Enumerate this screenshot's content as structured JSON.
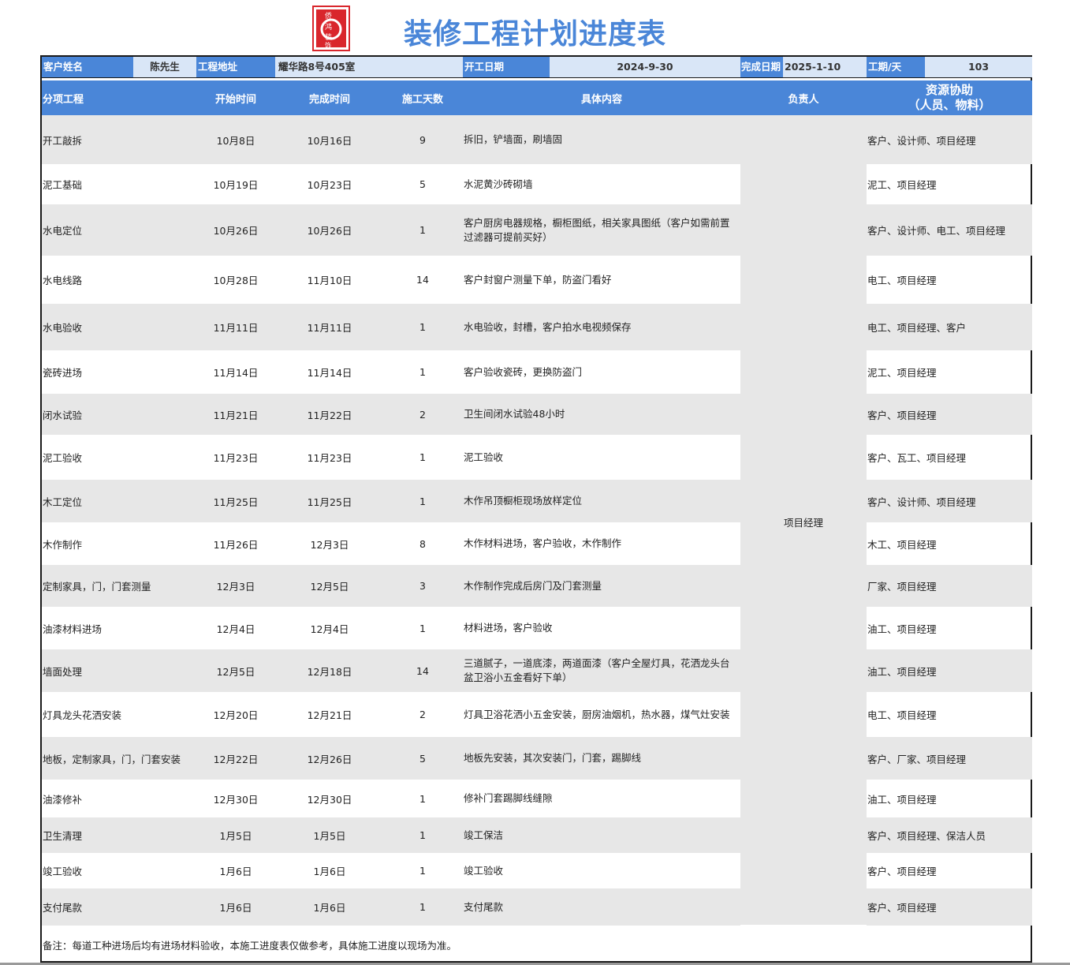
{
  "title": "装修工程计划进度表",
  "logo": {
    "text": "侨鸿装饰",
    "color": "#d9262c"
  },
  "colors": {
    "accent": "#4a86d8",
    "light": "#d9e6f7",
    "stripe": "#e7e7e7"
  },
  "info": {
    "customer_label": "客户姓名",
    "customer_value": "陈先生",
    "address_label": "工程地址",
    "address_value": "耀华路8号405室",
    "start_label": "开工日期",
    "start_value": "2024-9-30",
    "finish_label": "完成日期",
    "finish_value": "2025-1-10",
    "duration_label": "工期/天",
    "duration_value": "103"
  },
  "headers": {
    "item": "分项工程",
    "start": "开始时间",
    "end": "完成时间",
    "days": "施工天数",
    "content": "具体内容",
    "leader": "负责人",
    "resource_1": "资源协助",
    "resource_2": "（人员、物料）"
  },
  "leader": "项目经理",
  "rows": [
    {
      "item": "开工敲拆",
      "start": "10月8日",
      "end": "10月16日",
      "days": "9",
      "content": "拆旧，铲墙面，刷墙固",
      "resource": "客户、设计师、项目经理"
    },
    {
      "item": "泥工基础",
      "start": "10月19日",
      "end": "10月23日",
      "days": "5",
      "content": "水泥黄沙砖砌墙",
      "resource": "泥工、项目经理"
    },
    {
      "item": "水电定位",
      "start": "10月26日",
      "end": "10月26日",
      "days": "1",
      "content": "客户厨房电器规格，橱柜图纸，相关家具图纸（客户如需前置过滤器可提前买好）",
      "resource": "客户、设计师、电工、项目经理"
    },
    {
      "item": "水电线路",
      "start": "10月28日",
      "end": "11月10日",
      "days": "14",
      "content": "客户封窗户测量下单，防盗门看好",
      "resource": "电工、项目经理"
    },
    {
      "item": "水电验收",
      "start": "11月11日",
      "end": "11月11日",
      "days": "1",
      "content": "水电验收，封槽，客户拍水电视频保存",
      "resource": "电工、项目经理、客户"
    },
    {
      "item": "瓷砖进场",
      "start": "11月14日",
      "end": "11月14日",
      "days": "1",
      "content": "客户验收瓷砖，更换防盗门",
      "resource": "泥工、项目经理"
    },
    {
      "item": "闭水试验",
      "start": "11月21日",
      "end": "11月22日",
      "days": "2",
      "content": "卫生间闭水试验48小时",
      "resource": "客户、项目经理"
    },
    {
      "item": "泥工验收",
      "start": "11月23日",
      "end": "11月23日",
      "days": "1",
      "content": "泥工验收",
      "resource": "客户、瓦工、项目经理"
    },
    {
      "item": "木工定位",
      "start": "11月25日",
      "end": "11月25日",
      "days": "1",
      "content": "木作吊顶橱柜现场放样定位",
      "resource": "客户、设计师、项目经理"
    },
    {
      "item": "木作制作",
      "start": "11月26日",
      "end": "12月3日",
      "days": "8",
      "content": "木作材料进场，客户验收，木作制作",
      "resource": "木工、项目经理"
    },
    {
      "item": "定制家具，门，门套测量",
      "start": "12月3日",
      "end": "12月5日",
      "days": "3",
      "content": "木作制作完成后房门及门套测量",
      "resource": "厂家、项目经理"
    },
    {
      "item": "油漆材料进场",
      "start": "12月4日",
      "end": "12月4日",
      "days": "1",
      "content": "材料进场，客户验收",
      "resource": "油工、项目经理"
    },
    {
      "item": "墙面处理",
      "start": "12月5日",
      "end": "12月18日",
      "days": "14",
      "content": "三道腻子，一道底漆，两道面漆（客户全屋灯具，花洒龙头台盆卫浴小五金看好下单）",
      "resource": "油工、项目经理"
    },
    {
      "item": "灯具龙头花洒安装",
      "start": "12月20日",
      "end": "12月21日",
      "days": "2",
      "content": "灯具卫浴花洒小五金安装，厨房油烟机，热水器，煤气灶安装",
      "resource": "电工、项目经理"
    },
    {
      "item": "地板，定制家具，门，门套安装",
      "start": "12月22日",
      "end": "12月26日",
      "days": "5",
      "content": "地板先安装，其次安装门，门套，踢脚线",
      "resource": "客户、厂家、项目经理"
    },
    {
      "item": "油漆修补",
      "start": "12月30日",
      "end": "12月30日",
      "days": "1",
      "content": "修补门套踢脚线缝隙",
      "resource": "油工、项目经理"
    },
    {
      "item": "卫生清理",
      "start": "1月5日",
      "end": "1月5日",
      "days": "1",
      "content": "竣工保洁",
      "resource": "客户、项目经理、保洁人员"
    },
    {
      "item": "竣工验收",
      "start": "1月6日",
      "end": "1月6日",
      "days": "1",
      "content": "竣工验收",
      "resource": "客户、项目经理"
    },
    {
      "item": "支付尾款",
      "start": "1月6日",
      "end": "1月6日",
      "days": "1",
      "content": "支付尾款",
      "resource": "客户、项目经理"
    }
  ],
  "note": "备注：每道工种进场后均有进场材料验收，本施工进度表仅做参考，具体施工进度以现场为准。"
}
